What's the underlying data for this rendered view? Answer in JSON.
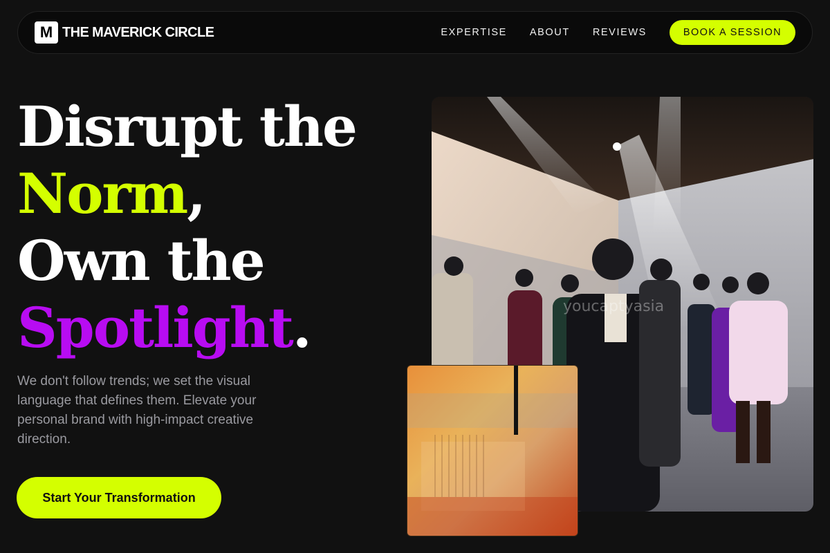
{
  "brand": {
    "mark": "M",
    "name": "THE MAVERICK CIRCLE"
  },
  "nav": {
    "links": [
      "EXPERTISE",
      "ABOUT",
      "REVIEWS"
    ],
    "cta": "BOOK A SESSION"
  },
  "hero": {
    "line1": "Disrupt the",
    "line2_highlight": "Norm",
    "line2_rest": ",",
    "line3": "Own the",
    "line4_highlight": "Spotlight",
    "line4_rest": ".",
    "subtext": "We don't follow trends; we set the visual language that defines them. Elevate your personal brand with high-impact creative direction.",
    "cta": "Start Your Transformation"
  },
  "images": {
    "photo_watermark": "youcaptyasia",
    "photo_label": "fashion-show-photo",
    "artwork_label": "abstract-orange-artwork"
  },
  "colors": {
    "accent_green": "#d4ff00",
    "accent_purple": "#b80cf2",
    "background": "#111111"
  }
}
